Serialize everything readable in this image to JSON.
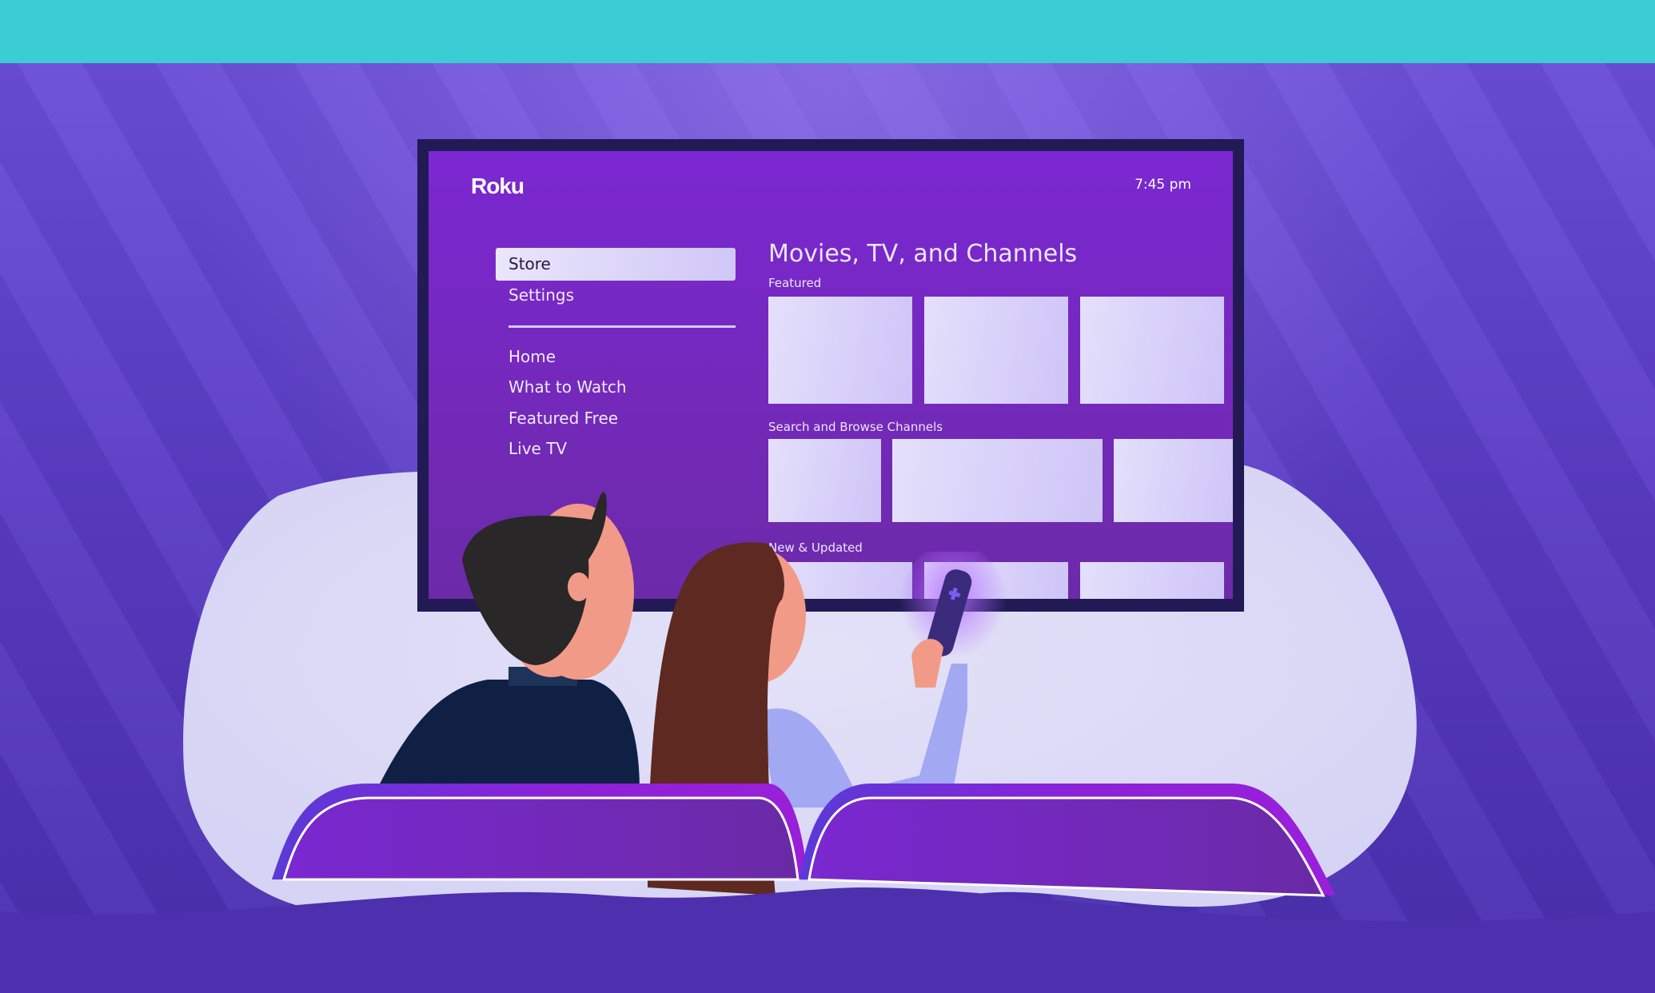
{
  "colors": {
    "top_bar": "#3acdd3",
    "background": "#5a3cc4",
    "tv_frame": "#211a55",
    "screen": "#7b28d2",
    "tile": "#dcd6fa",
    "couch": "#7328c4"
  },
  "tv": {
    "logo": "Roku",
    "clock": "7:45 pm",
    "menu": {
      "selected": "Store",
      "top_items": [
        "Store",
        "Settings"
      ],
      "items": [
        "Home",
        "What to Watch",
        "Featured Free",
        "Live TV"
      ]
    },
    "content": {
      "title": "Movies, TV, and Channels",
      "sections": [
        {
          "label": "Featured",
          "tile_count": 3
        },
        {
          "label": "Search and Browse Channels",
          "tile_count": 3
        },
        {
          "label": "New & Updated",
          "tile_count": 3
        }
      ]
    }
  },
  "scene": {
    "characters": [
      "man-viewer",
      "woman-viewer"
    ],
    "props": [
      "remote-control",
      "couch"
    ]
  }
}
